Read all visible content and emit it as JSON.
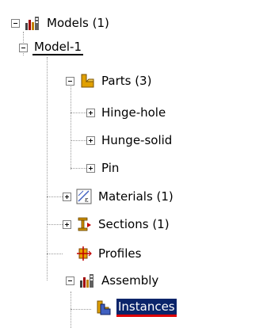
{
  "tree": {
    "models": {
      "label": "Models (1)",
      "icon": "models-icon",
      "expander": "minus"
    },
    "model1": {
      "label": "Model-1",
      "expander": "minus"
    },
    "parts": {
      "label": "Parts (3)",
      "icon": "parts-icon",
      "expander": "minus"
    },
    "part_items": [
      {
        "label": "Hinge-hole",
        "expander": "plus"
      },
      {
        "label": "Hunge-solid",
        "expander": "plus"
      },
      {
        "label": "Pin",
        "expander": "plus"
      }
    ],
    "materials": {
      "label": "Materials (1)",
      "icon": "materials-icon",
      "expander": "plus"
    },
    "sections": {
      "label": "Sections (1)",
      "icon": "sections-icon",
      "expander": "plus"
    },
    "profiles": {
      "label": "Profiles",
      "icon": "profiles-icon"
    },
    "assembly": {
      "label": "Assembly",
      "icon": "assembly-icon",
      "expander": "minus"
    },
    "instances": {
      "label": "Instances",
      "icon": "instances-icon",
      "selected": true
    }
  },
  "colors": {
    "selection_bg": "#0a246a",
    "selection_text": "#ffffff",
    "selection_underline": "#e00000",
    "connector": "#9a9a9a",
    "parts_icon": "#e0a000"
  }
}
